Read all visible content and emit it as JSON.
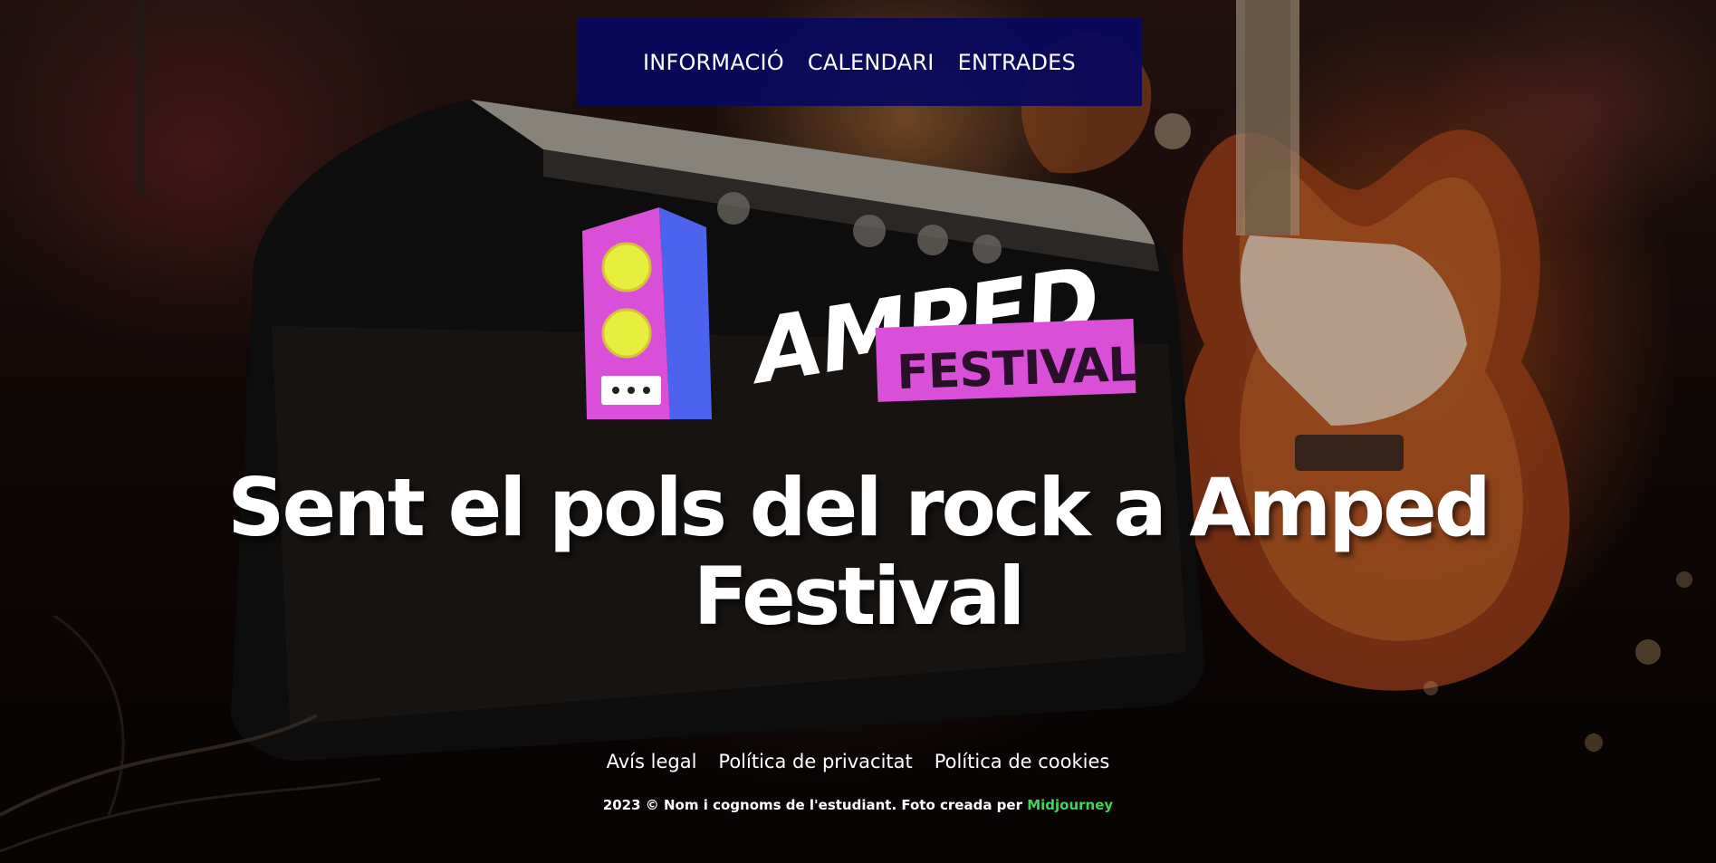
{
  "nav": {
    "items": [
      {
        "label": "INFORMACIÓ"
      },
      {
        "label": "CALENDARI"
      },
      {
        "label": "ENTRADES"
      }
    ],
    "background_color": "#08085f"
  },
  "logo": {
    "word_main": "AMPED",
    "word_sub": "FESTIVAL",
    "colors": {
      "speaker_front": "#d94fd8",
      "speaker_side": "#4c63f0",
      "speaker_cone": "#e6ef3e",
      "badge": "#d94fd8"
    }
  },
  "hero": {
    "headline_line1": "Sent el pols del rock a Amped",
    "headline_line2": "Festival"
  },
  "footer": {
    "links": [
      {
        "label": "Avís legal"
      },
      {
        "label": "Política de privacitat"
      },
      {
        "label": "Política de cookies"
      }
    ],
    "copyright_text": "2023 © Nom i cognoms de l'estudiant. Foto creada per ",
    "credit_link": "Midjourney",
    "credit_color": "#41d35a"
  }
}
